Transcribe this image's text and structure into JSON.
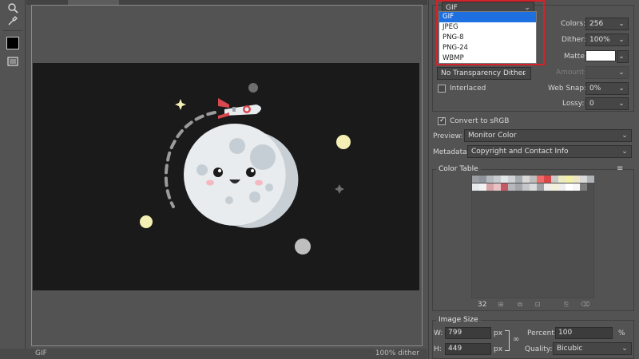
{
  "status_bar": {
    "format": "GIF",
    "dither": "100% dither"
  },
  "format_dropdown": {
    "value": "GIF",
    "options": [
      "GIF",
      "JPEG",
      "PNG-8",
      "PNG-24",
      "WBMP"
    ],
    "selected_index": 0
  },
  "settings": {
    "colors_label": "Colors:",
    "colors_value": "256",
    "dither_label": "Dither:",
    "dither_value": "100%",
    "matte_label": "Matte:",
    "matte_color": "#ffffff",
    "amount_label": "Amount:",
    "transparency_dither": "No Transparency Dither",
    "interlaced_label": "Interlaced",
    "interlaced": false,
    "web_snap_label": "Web Snap:",
    "web_snap_value": "0%",
    "lossy_label": "Lossy:",
    "lossy_value": "0"
  },
  "convert_srgb": {
    "label": "Convert to sRGB",
    "checked": true
  },
  "preview": {
    "label": "Preview:",
    "value": "Monitor Color"
  },
  "metadata": {
    "label": "Metadata:",
    "value": "Copyright and Contact Info"
  },
  "color_table": {
    "title": "Color Table",
    "count": "32",
    "swatches": [
      "#9a9ea3",
      "#8e949a",
      "#b6babf",
      "#c8ccd0",
      "#e3e6e8",
      "#cfd3d6",
      "#a8adb2",
      "#d8d8d8",
      "#bdbdbd",
      "#ef6a6a",
      "#d84848",
      "#c9c9c9",
      "#ecebc0",
      "#f1efa8",
      "#ede6c8",
      "#d9d9d9",
      "#b0b4b8",
      "#e6e8ea",
      "#f2f2f2",
      "#d6a3a8",
      "#e9c2c6",
      "#c35a63",
      "#b6b8bb",
      "#a3a6aa",
      "#c4c6c9",
      "#d8dadc",
      "#9ea1a6",
      "#efeeea",
      "#f5f1d8",
      "#eeeeee",
      "#ffffff",
      "#f7f7f7",
      "#7d7d7d"
    ]
  },
  "image_size": {
    "title": "Image Size",
    "w_label": "W:",
    "w_value": "799",
    "w_unit": "px",
    "h_label": "H:",
    "h_value": "449",
    "h_unit": "px",
    "percent_label": "Percent:",
    "percent_value": "100",
    "percent_unit": "%",
    "quality_label": "Quality:",
    "quality_value": "Bicubic"
  },
  "colors": {
    "accent": "#1e6fe0",
    "highlight": "#d2232a",
    "canvas": "#1a1a1a",
    "panel": "#535353"
  }
}
